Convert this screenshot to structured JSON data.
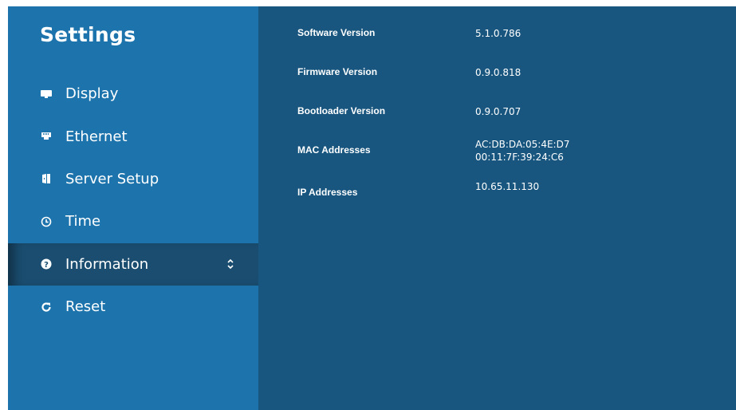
{
  "sidebar": {
    "title": "Settings",
    "items": [
      {
        "label": "Display",
        "icon": "monitor-icon"
      },
      {
        "label": "Ethernet",
        "icon": "ethernet-icon"
      },
      {
        "label": "Server Setup",
        "icon": "server-icon"
      },
      {
        "label": "Time",
        "icon": "clock-icon"
      },
      {
        "label": "Information",
        "icon": "help-circle-icon",
        "selected": true
      },
      {
        "label": "Reset",
        "icon": "refresh-icon"
      }
    ]
  },
  "info": {
    "software_label": "Software Version",
    "software_value": "5.1.0.786",
    "firmware_label": "Firmware Version",
    "firmware_value": "0.9.0.818",
    "bootloader_label": "Bootloader Version",
    "bootloader_value": "0.9.0.707",
    "mac_label": "MAC Addresses",
    "mac_values": [
      "AC:DB:DA:05:4E:D7",
      "00:11:7F:39:24:C6"
    ],
    "ip_label": "IP Addresses",
    "ip_values": [
      "10.65.11.130"
    ]
  },
  "colors": {
    "sidebar_bg": "#1d74ad",
    "selected_bg": "#1a4d70",
    "content_bg": "#18567f",
    "text": "#ffffff"
  }
}
